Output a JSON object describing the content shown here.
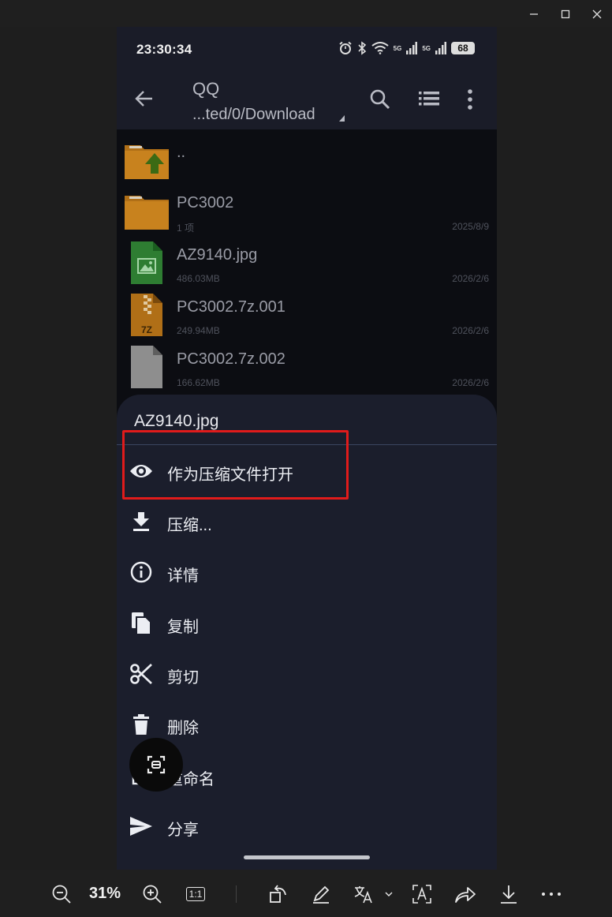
{
  "phone": {
    "status": {
      "time": "23:30:34",
      "battery": "68",
      "signal_1": "5G",
      "signal_2": "5G"
    },
    "toolbar": {
      "title": "QQ",
      "path": "...ted/0/Download"
    },
    "files": [
      {
        "name": "..",
        "sub": "",
        "date": "",
        "type": "parent-folder"
      },
      {
        "name": "PC3002",
        "sub": "1 项",
        "date": "2025/8/9",
        "type": "folder"
      },
      {
        "name": "AZ9140.jpg",
        "sub": "486.03MB",
        "date": "2026/2/6",
        "type": "image"
      },
      {
        "name": "PC3002.7z.001",
        "sub": "249.94MB",
        "date": "2026/2/6",
        "type": "archive",
        "badge": "7Z"
      },
      {
        "name": "PC3002.7z.002",
        "sub": "166.62MB",
        "date": "2026/2/6",
        "type": "file"
      }
    ],
    "sheet": {
      "title": "AZ9140.jpg",
      "items": [
        {
          "label": "作为压缩文件打开",
          "icon": "eye-icon"
        },
        {
          "label": "压缩...",
          "icon": "download-icon"
        },
        {
          "label": "详情",
          "icon": "info-icon"
        },
        {
          "label": "复制",
          "icon": "copy-icon"
        },
        {
          "label": "剪切",
          "icon": "scissors-icon"
        },
        {
          "label": "删除",
          "icon": "trash-icon"
        },
        {
          "label": "重命名",
          "icon": "rename-icon"
        },
        {
          "label": "分享",
          "icon": "send-icon"
        }
      ]
    }
  },
  "viewer": {
    "zoom": "31%",
    "actual_size_label": "1:1"
  },
  "colors": {
    "highlight": "#e01b1b",
    "sheet_bg": "#1b1e2c",
    "folder": "#c8821e",
    "image_file": "#2e7d32"
  }
}
